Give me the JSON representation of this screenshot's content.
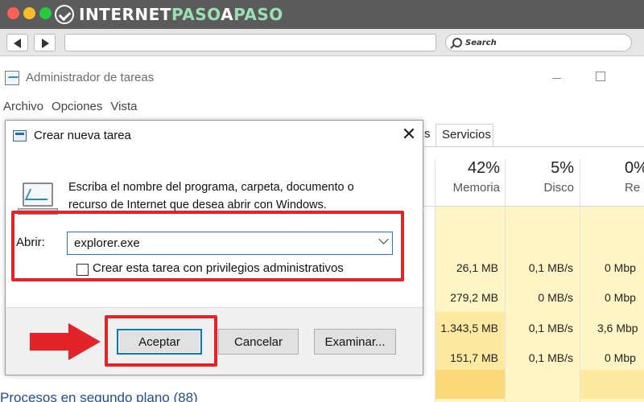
{
  "browser": {
    "logo": {
      "part1": "INTERNET",
      "part2": "PASO",
      "part3": "A",
      "part4": "PASO"
    },
    "search_placeholder": "Search"
  },
  "task_manager": {
    "title": "Administrador de tareas",
    "menu": [
      "Archivo",
      "Opciones",
      "Vista"
    ],
    "tab_partial": "s",
    "tab_servicios": "Servicios",
    "columns": [
      {
        "pct": "42%",
        "label": "Memoria"
      },
      {
        "pct": "5%",
        "label": "Disco"
      },
      {
        "pct": "0%",
        "label": "Re"
      }
    ],
    "rows": [
      {
        "memoria": "26,1 MB",
        "disco": "0,1 MB/s",
        "red": "0 Mbp"
      },
      {
        "memoria": "279,2 MB",
        "disco": "0 MB/s",
        "red": "0 Mbp"
      },
      {
        "memoria": "1.343,5 MB",
        "disco": "0,1 MB/s",
        "red": "3,6 Mbp"
      },
      {
        "memoria": "151,7 MB",
        "disco": "0,1 MB/s",
        "red": "0 Mbp"
      }
    ],
    "section_label": "Procesos en segundo plano (88)",
    "colors": {
      "heat_light": "#fff4c4",
      "heat_mid": "#fde9a0",
      "heat_strong": "#fbd979"
    }
  },
  "dialog": {
    "title": "Crear nueva tarea",
    "close_glyph": "✕",
    "description": "Escriba el nombre del programa, carpeta, documento o recurso de Internet que desea abrir con Windows.",
    "open_label": "Abrir:",
    "open_value": "explorer.exe",
    "admin_checkbox_label": "Crear esta tarea con privilegios administrativos",
    "admin_checked": false,
    "buttons": {
      "ok": "Aceptar",
      "cancel": "Cancelar",
      "browse": "Examinar..."
    }
  },
  "highlight_color": "#e3232a"
}
